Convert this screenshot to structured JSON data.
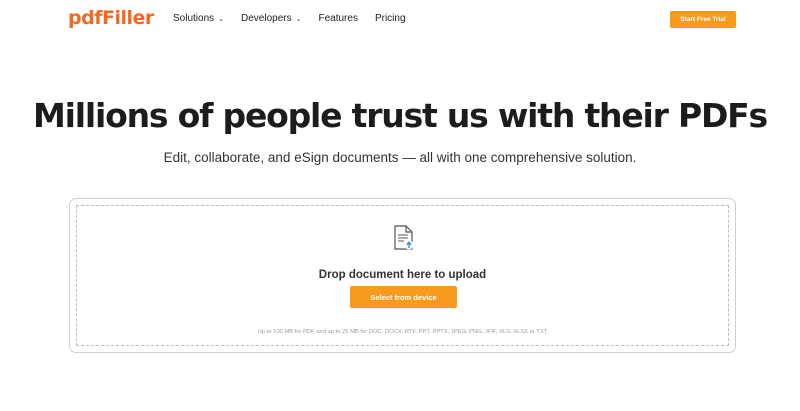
{
  "header": {
    "logo_text": "pdfFiller",
    "nav": [
      {
        "label": "Solutions",
        "has_dropdown": true
      },
      {
        "label": "Developers",
        "has_dropdown": true
      },
      {
        "label": "Features",
        "has_dropdown": false
      },
      {
        "label": "Pricing",
        "has_dropdown": false
      }
    ],
    "cta_label": "Start Free Trial"
  },
  "hero": {
    "title": "Millions of people trust us with their PDFs",
    "subtitle": "Edit, collaborate, and eSign documents — all with one comprehensive solution."
  },
  "upload": {
    "icon": "document-upload-icon",
    "drop_text": "Drop document here to upload",
    "button_label": "Select from device",
    "limits_text": "Up to 100 MB for PDF and up to 25 MB for DOC, DOCX, RTF, PPT, PPTX, JPEG, PNG, JFIF, XLS, XLSX or TXT"
  },
  "colors": {
    "brand": "#f26a21",
    "accent": "#f79a1e",
    "upload_arrow": "#2d8fe0"
  }
}
